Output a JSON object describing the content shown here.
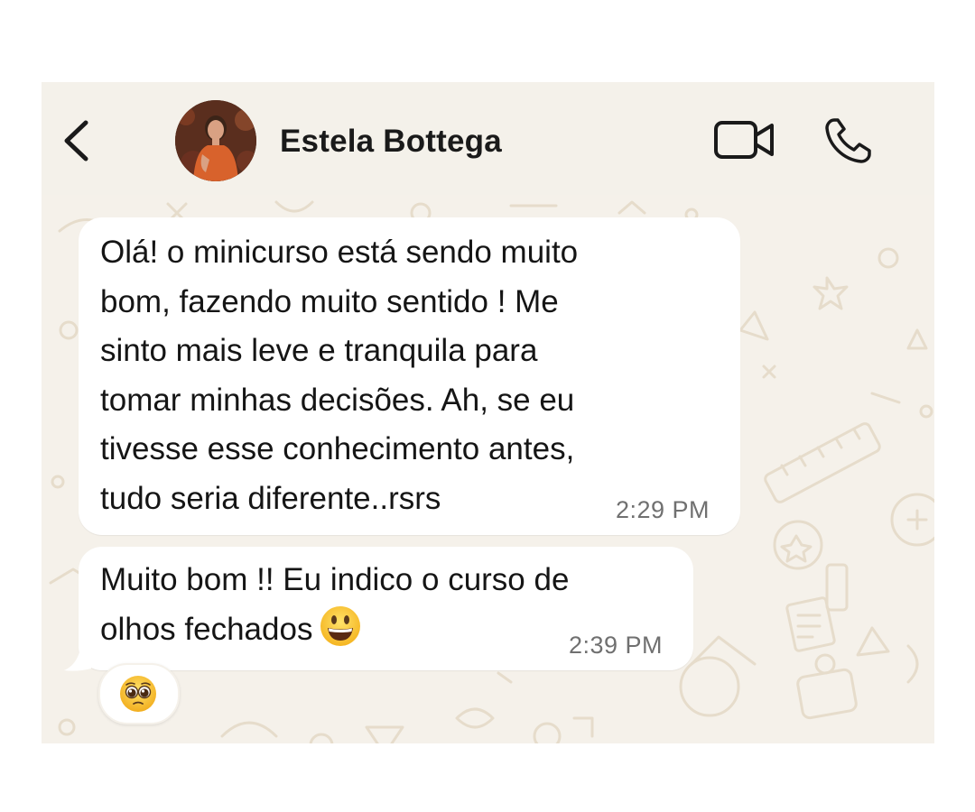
{
  "header": {
    "contact_name": "Estela Bottega",
    "icons": [
      "chevron-left-icon",
      "video-camera-icon",
      "phone-icon"
    ]
  },
  "messages": [
    {
      "lines": [
        "Olá!  o minicurso está sendo muito",
        "bom, fazendo muito sentido ! Me",
        "sinto mais leve e tranquila para",
        "tomar minhas decisões. Ah, se eu",
        "tivesse esse conhecimento antes,",
        "tudo seria diferente..rsrs"
      ],
      "time": "2:29 PM"
    },
    {
      "lines": [
        "Muito bom !! Eu indico o curso de",
        "olhos fechados"
      ],
      "emoji": "grinning-face-emoji",
      "time": "2:39 PM",
      "reaction": "pleading-face-emoji"
    }
  ],
  "colors": {
    "wallpaper": "#f5f1ea",
    "doodle": "#e6dccb",
    "bubble": "#ffffff",
    "text": "#151515",
    "timestamp": "#707070"
  }
}
